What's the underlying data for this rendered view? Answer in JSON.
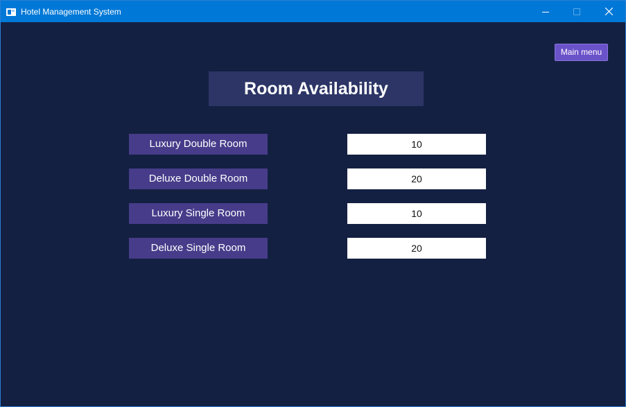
{
  "window": {
    "title": "Hotel Management System",
    "titlebar_color": "#0078d7",
    "background_color": "#142042",
    "controls": [
      "minimize-icon",
      "maximize-icon",
      "close-icon"
    ]
  },
  "header": {
    "main_menu_label": "Main menu",
    "main_menu_color": "#6a52c9"
  },
  "main": {
    "title": "Room Availability",
    "rooms": [
      {
        "label": "Luxury Double Room",
        "value": "10"
      },
      {
        "label": "Deluxe Double Room",
        "value": "20"
      },
      {
        "label": "Luxury Single Room",
        "value": "10"
      },
      {
        "label": "Deluxe Single Room",
        "value": "20"
      }
    ],
    "label_color": "#473c8a",
    "title_color": "#2c3566"
  }
}
